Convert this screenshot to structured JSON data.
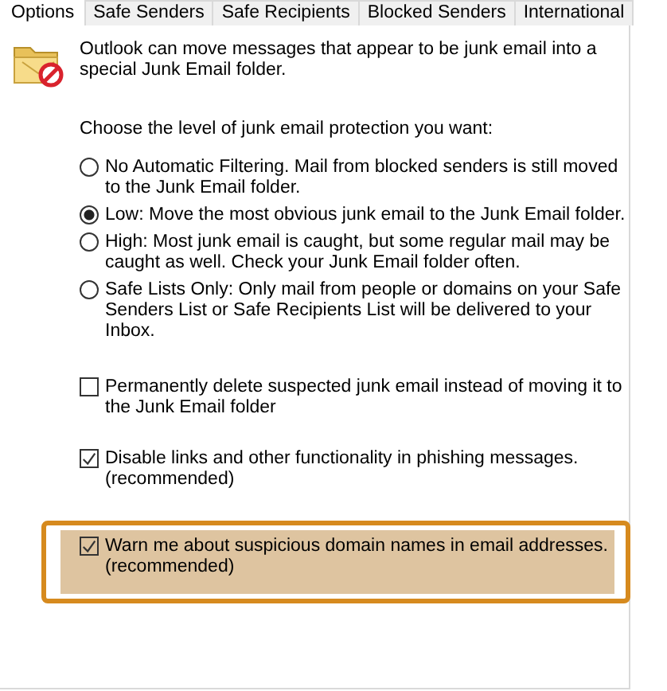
{
  "tabs": [
    {
      "label": "Options",
      "selected": true
    },
    {
      "label": "Safe Senders",
      "selected": false
    },
    {
      "label": "Safe Recipients",
      "selected": false
    },
    {
      "label": "Blocked Senders",
      "selected": false
    },
    {
      "label": "International",
      "selected": false
    }
  ],
  "intro": "Outlook can move messages that appear to be junk email into a special Junk Email folder.",
  "prompt": "Choose the level of junk email protection you want:",
  "levels": [
    {
      "label": "No Automatic Filtering. Mail from blocked senders is still moved to the Junk Email folder.",
      "selected": false
    },
    {
      "label": "Low: Move the most obvious junk email to the Junk Email folder.",
      "selected": true
    },
    {
      "label": "High: Most junk email is caught, but some regular mail may be caught as well. Check your Junk Email folder often.",
      "selected": false
    },
    {
      "label": "Safe Lists Only: Only mail from people or domains on your Safe Senders List or Safe Recipients List will be delivered to your Inbox.",
      "selected": false
    }
  ],
  "options": [
    {
      "label": "Permanently delete suspected junk email instead of moving it to the Junk Email folder",
      "checked": false,
      "highlighted": false
    },
    {
      "label": "Disable links and other functionality in phishing messages. (recommended)",
      "checked": true,
      "highlighted": false
    },
    {
      "label": "Warn me about suspicious domain names in email addresses. (recommended)",
      "checked": true,
      "highlighted": true
    }
  ]
}
